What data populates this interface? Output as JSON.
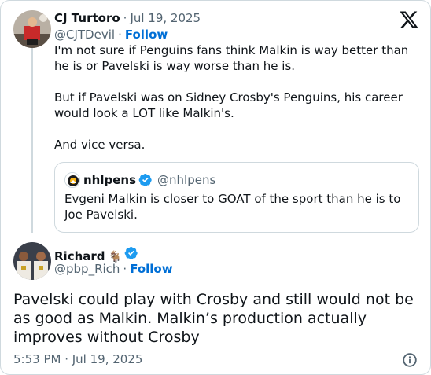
{
  "post": {
    "author_name": "CJ Turtoro",
    "separator": "·",
    "date": "Jul 19, 2025",
    "handle": "@CJTDevil",
    "follow_label": "Follow",
    "paragraphs": [
      "I'm not sure if Penguins fans think Malkin is way better than he is or Pavelski is way worse than he is.",
      "But if Pavelski was on Sidney Crosby's Penguins, his career would look a LOT like Malkin's.",
      "And vice versa."
    ]
  },
  "quoted": {
    "author_name": "nhlpens",
    "handle": "@nhlpens",
    "text": "Evgeni Malkin is closer to GOAT of the sport than he is to Joe Pavelski."
  },
  "reply": {
    "author_name": "Richard",
    "emoji": "🐐",
    "handle": "@pbp_Rich",
    "separator": "·",
    "follow_label": "Follow",
    "text": "Pavelski could play with Crosby and still would not be as good as Malkin. Malkin’s production actually improves without Crosby",
    "timestamp": "5:53 PM · Jul 19, 2025"
  },
  "colors": {
    "follow": "#006fd6",
    "verified": "#1d9bf0",
    "muted": "#536471",
    "border": "#cfd9de"
  },
  "icons": [
    "x-logo-icon",
    "verified-badge-icon",
    "info-icon"
  ]
}
